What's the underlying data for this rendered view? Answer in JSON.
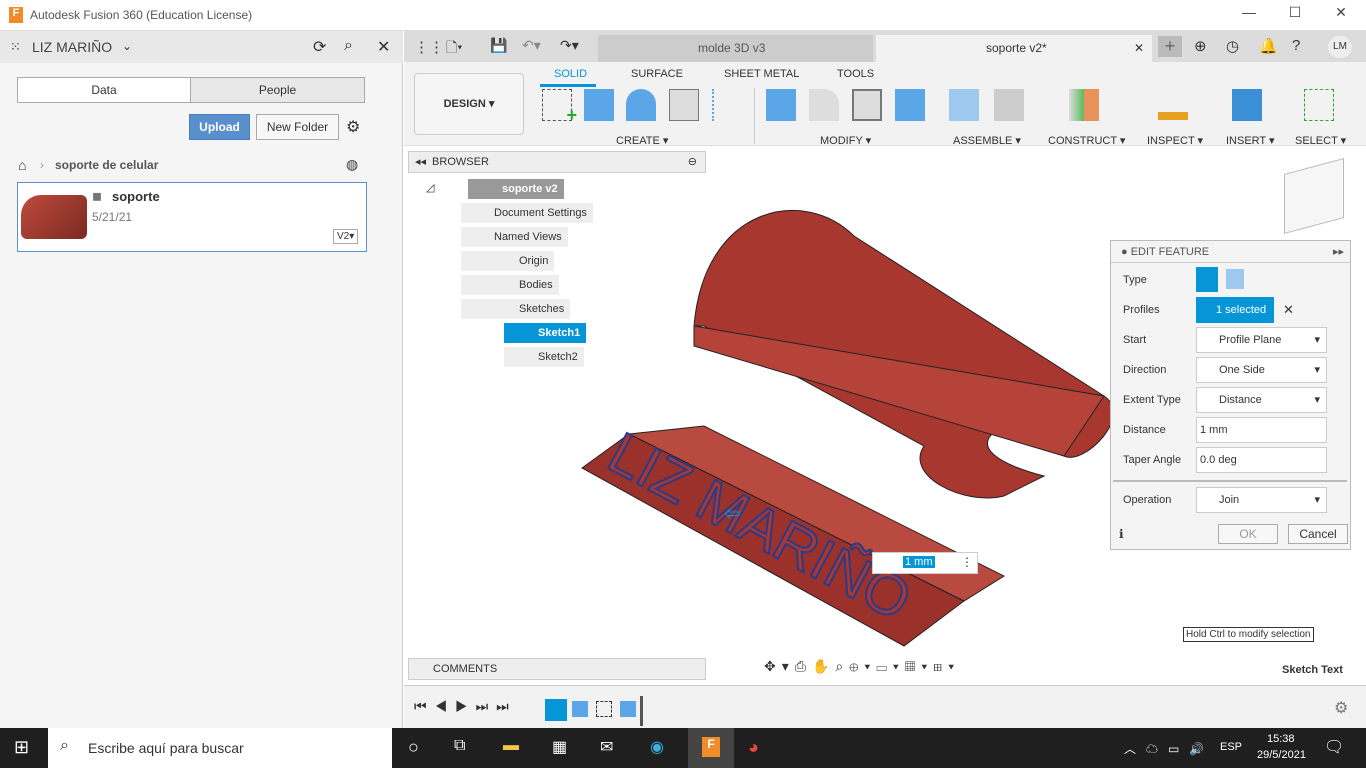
{
  "window": {
    "title": "Autodesk Fusion 360 (Education License)"
  },
  "data_panel": {
    "user": "LIZ MARIÑO",
    "tabs": [
      "Data",
      "People"
    ],
    "upload": "Upload",
    "new_folder": "New Folder",
    "breadcrumb": "soporte de celular",
    "item": {
      "name": "soporte",
      "date": "5/21/21",
      "version": "V2"
    }
  },
  "doc_tabs": [
    {
      "label": "molde 3D v3",
      "active": false
    },
    {
      "label": "soporte v2*",
      "active": true
    }
  ],
  "user_initials": "LM",
  "toolbar": {
    "workspace": "DESIGN",
    "tabs": [
      "SOLID",
      "SURFACE",
      "SHEET METAL",
      "TOOLS"
    ],
    "groups": [
      "CREATE",
      "MODIFY",
      "ASSEMBLE",
      "CONSTRUCT",
      "INSPECT",
      "INSERT",
      "SELECT"
    ]
  },
  "browser": {
    "title": "BROWSER",
    "root": "soporte v2",
    "items": [
      "Document Settings",
      "Named Views",
      "Origin",
      "Bodies",
      "Sketches"
    ],
    "sketches": [
      "Sketch1",
      "Sketch2"
    ],
    "comments": "COMMENTS"
  },
  "model": {
    "text": "LIZ MARIÑO",
    "distance_input": "1 mm"
  },
  "edit_feature": {
    "title": "EDIT FEATURE",
    "type_label": "Type",
    "profiles_label": "Profiles",
    "profiles_value": "1 selected",
    "start_label": "Start",
    "start_value": "Profile Plane",
    "direction_label": "Direction",
    "direction_value": "One Side",
    "extent_label": "Extent Type",
    "extent_value": "Distance",
    "distance_label": "Distance",
    "distance_value": "1 mm",
    "taper_label": "Taper Angle",
    "taper_value": "0.0 deg",
    "operation_label": "Operation",
    "operation_value": "Join",
    "ok": "OK",
    "cancel": "Cancel"
  },
  "hint": "Hold Ctrl to modify selection",
  "status": "Sketch Text",
  "taskbar": {
    "search": "Escribe aquí para buscar",
    "lang": "ESP",
    "time": "15:38",
    "date": "29/5/2021"
  },
  "colors": {
    "accent": "#0696d7",
    "model": "#a8372f"
  }
}
